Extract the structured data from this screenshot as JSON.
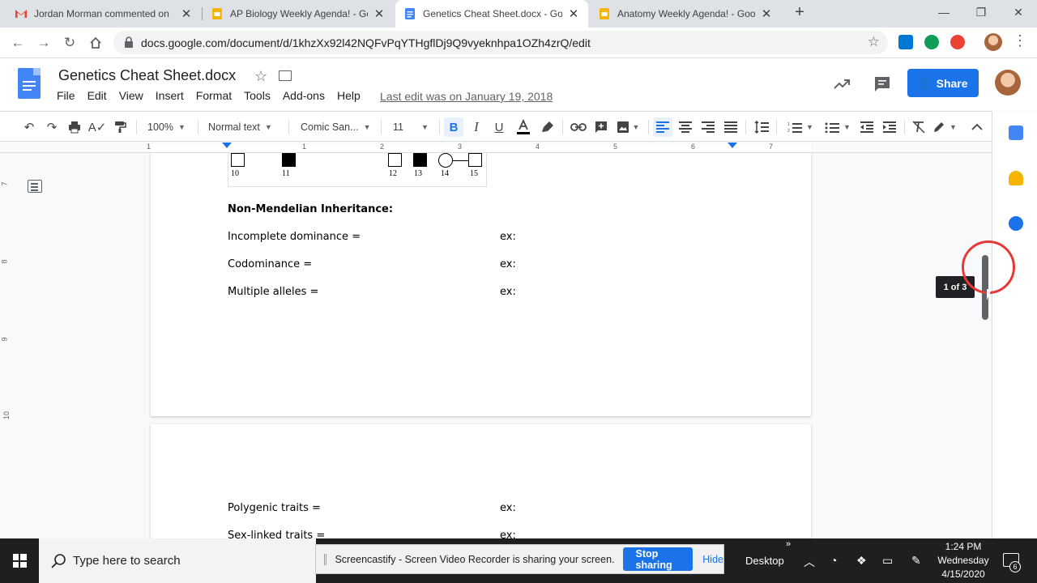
{
  "browser": {
    "tabs": [
      {
        "label": "Jordan Morman commented on",
        "favicon": "gmail-icon"
      },
      {
        "label": "AP Biology Weekly Agenda! - Go",
        "favicon": "slides-icon"
      },
      {
        "label": "Genetics Cheat Sheet.docx - Goo",
        "favicon": "docs-icon",
        "active": true
      },
      {
        "label": "Anatomy Weekly Agenda! - Goo",
        "favicon": "slides-icon"
      }
    ],
    "url": "docs.google.com/document/d/1khzXx92l42NQFvPqYTHgflDj9Q9vyeknhpa1OZh4zrQ/edit"
  },
  "docs": {
    "title": "Genetics Cheat Sheet.docx",
    "menu": [
      "File",
      "Edit",
      "View",
      "Insert",
      "Format",
      "Tools",
      "Add-ons",
      "Help"
    ],
    "last_edit": "Last edit was on January 19, 2018",
    "share_label": "Share"
  },
  "toolbar": {
    "zoom": "100%",
    "style": "Normal text",
    "font": "Comic San...",
    "size": "11",
    "bold_active": true,
    "align_left_active": true
  },
  "ruler": {
    "h_numbers": [
      "1",
      "1",
      "2",
      "3",
      "4",
      "5",
      "6",
      "7"
    ],
    "v_numbers": [
      "7",
      "8",
      "9",
      "10"
    ]
  },
  "document": {
    "pedigree_numbers": [
      "10",
      "11",
      "12",
      "13",
      "14",
      "15"
    ],
    "heading": "Non-Mendelian Inheritance:",
    "rows_page1": [
      {
        "label": "Incomplete dominance =",
        "ex": "ex:"
      },
      {
        "label": "Codominance =",
        "ex": "ex:"
      },
      {
        "label": "Multiple alleles =",
        "ex": "ex:"
      }
    ],
    "rows_page2": [
      {
        "label": "Polygenic traits =",
        "ex": "ex:"
      },
      {
        "label": "Sex-linked traits =",
        "ex": "ex:"
      }
    ]
  },
  "page_indicator": "1 of 3",
  "taskbar": {
    "search_placeholder": "Type here to search",
    "screencastify_message": "Screencastify - Screen Video Recorder is sharing your screen.",
    "stop_sharing": "Stop sharing",
    "hide": "Hide",
    "desktop_label": "Desktop",
    "time": "1:24 PM",
    "day": "Wednesday",
    "date": "4/15/2020",
    "notification_count": "6"
  },
  "colors": {
    "accent": "#1a73e8",
    "docs_blue": "#4285f4",
    "gmail_red": "#ea4335",
    "slides_yellow": "#f4b400",
    "click_ring": "#e53935"
  }
}
